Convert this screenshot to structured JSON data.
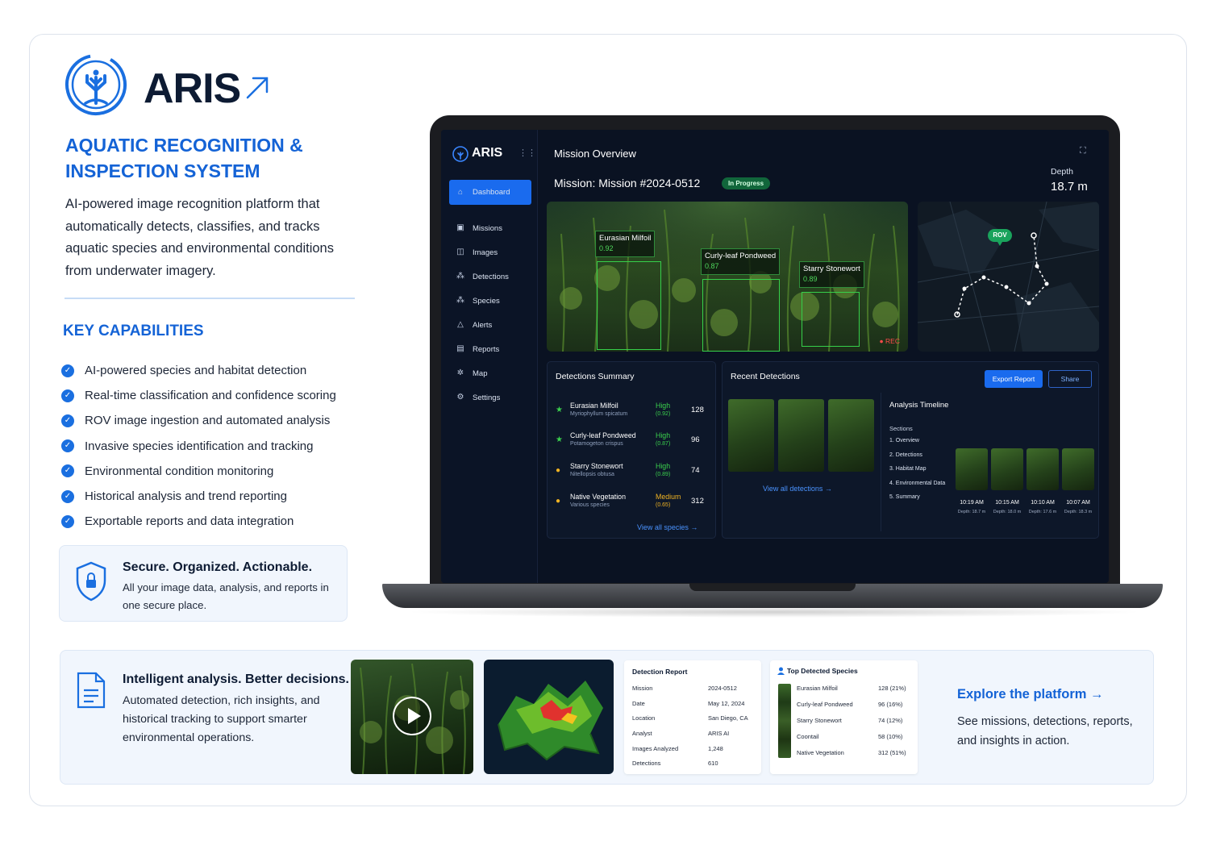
{
  "brand": {
    "name": "ARIS",
    "tagline": "AQUATIC RECOGNITION & INSPECTION SYSTEM",
    "accent": "#1463d6",
    "description": "AI-powered image recognition platform that automatically detects, classifies, and tracks aquatic species and environmental conditions from underwater imagery."
  },
  "capabilities": {
    "title": "KEY CAPABILITIES",
    "items": [
      "AI-powered species and habitat detection",
      "Real-time classification and confidence scoring",
      "ROV image ingestion and automated analysis",
      "Invasive species identification and tracking",
      "Environmental condition monitoring",
      "Historical analysis and trend reporting",
      "Exportable reports and data integration"
    ]
  },
  "secure": {
    "title": "Secure. Organized. Actionable.",
    "text": "All your image data, analysis, and reports in one secure place."
  },
  "app": {
    "name": "ARIS",
    "nav": [
      "Dashboard",
      "Missions",
      "Images",
      "Detections",
      "Species",
      "Alerts",
      "Reports",
      "Map",
      "Settings"
    ],
    "nav_icons": [
      "home-icon",
      "missions-icon",
      "images-icon",
      "detections-icon",
      "species-icon",
      "alert-icon",
      "report-icon",
      "map-icon",
      "gear-icon"
    ],
    "title": "Mission Overview",
    "mission": "Mission: Mission #2024-0512",
    "status": "In Progress",
    "depth_label": "Depth",
    "depth_value": "18.7 m",
    "camera": {
      "rec": "● REC",
      "detections": [
        {
          "label": "Eurasian Milfoil",
          "conf": "0.92"
        },
        {
          "label": "Curly-leaf Pondweed",
          "conf": "0.87"
        },
        {
          "label": "Starry Stonewort",
          "conf": "0.89"
        }
      ]
    },
    "map": {
      "rov_label": "ROV"
    },
    "summary": {
      "title": "Detections Summary",
      "link": "View all species →",
      "rows": [
        {
          "name": "Eurasian Milfoil",
          "sci": "Myriophyllum spicatum",
          "level": "High",
          "conf": "(0.92)",
          "count": "128",
          "icon": "★",
          "color": "#3bd14d"
        },
        {
          "name": "Curly-leaf Pondweed",
          "sci": "Potamogeton crispus",
          "level": "High",
          "conf": "(0.87)",
          "count": "96",
          "icon": "★",
          "color": "#3bd14d"
        },
        {
          "name": "Starry Stonewort",
          "sci": "Nitellopsis obtusa",
          "level": "High",
          "conf": "(0.89)",
          "count": "74",
          "icon": "●",
          "color": "#3bd14d"
        },
        {
          "name": "Native Vegetation",
          "sci": "Various species",
          "level": "Medium",
          "conf": "(0.65)",
          "count": "312",
          "icon": "●",
          "color": "#f0b322"
        }
      ]
    },
    "recent": {
      "title": "Recent Detections",
      "export": "Export Report",
      "share": "Share",
      "link": "View all detections →"
    },
    "timeline": {
      "title": "Analysis Timeline",
      "sections_label": "Sections",
      "sections": [
        "1.  Overview",
        "2.  Detections",
        "3.  Habitat Map",
        "4.  Environmental Data",
        "5.  Summary"
      ],
      "frames": [
        {
          "time": "10:19 AM",
          "depth": "Depth: 18.7 m"
        },
        {
          "time": "10:15 AM",
          "depth": "Depth: 18.0 m"
        },
        {
          "time": "10:10 AM",
          "depth": "Depth: 17.6 m"
        },
        {
          "time": "10:07 AM",
          "depth": "Depth: 18.3 m"
        }
      ]
    }
  },
  "band": {
    "title": "Intelligent analysis. Better decisions.",
    "text": "Automated detection, rich insights, and historical tracking to support smarter environmental operations.",
    "report": {
      "title": "Detection Report",
      "rows": [
        {
          "k": "Mission",
          "v": "2024-0512"
        },
        {
          "k": "Date",
          "v": "May 12, 2024"
        },
        {
          "k": "Location",
          "v": "San Diego, CA"
        },
        {
          "k": "Analyst",
          "v": "ARIS AI"
        },
        {
          "k": "Images Analyzed",
          "v": "1,248"
        },
        {
          "k": "Detections",
          "v": "610"
        }
      ]
    },
    "species": {
      "title": "Top Detected Species",
      "rows": [
        {
          "n": "Eurasian Milfoil",
          "v": "128 (21%)"
        },
        {
          "n": "Curly-leaf Pondweed",
          "v": "96 (16%)"
        },
        {
          "n": "Starry Stonewort",
          "v": "74 (12%)"
        },
        {
          "n": "Coontail",
          "v": "58 (10%)"
        },
        {
          "n": "Native Vegetation",
          "v": "312 (51%)"
        }
      ]
    },
    "explore_title": "Explore the platform →",
    "explore_text": "See missions, detections, reports, and insights in action."
  }
}
